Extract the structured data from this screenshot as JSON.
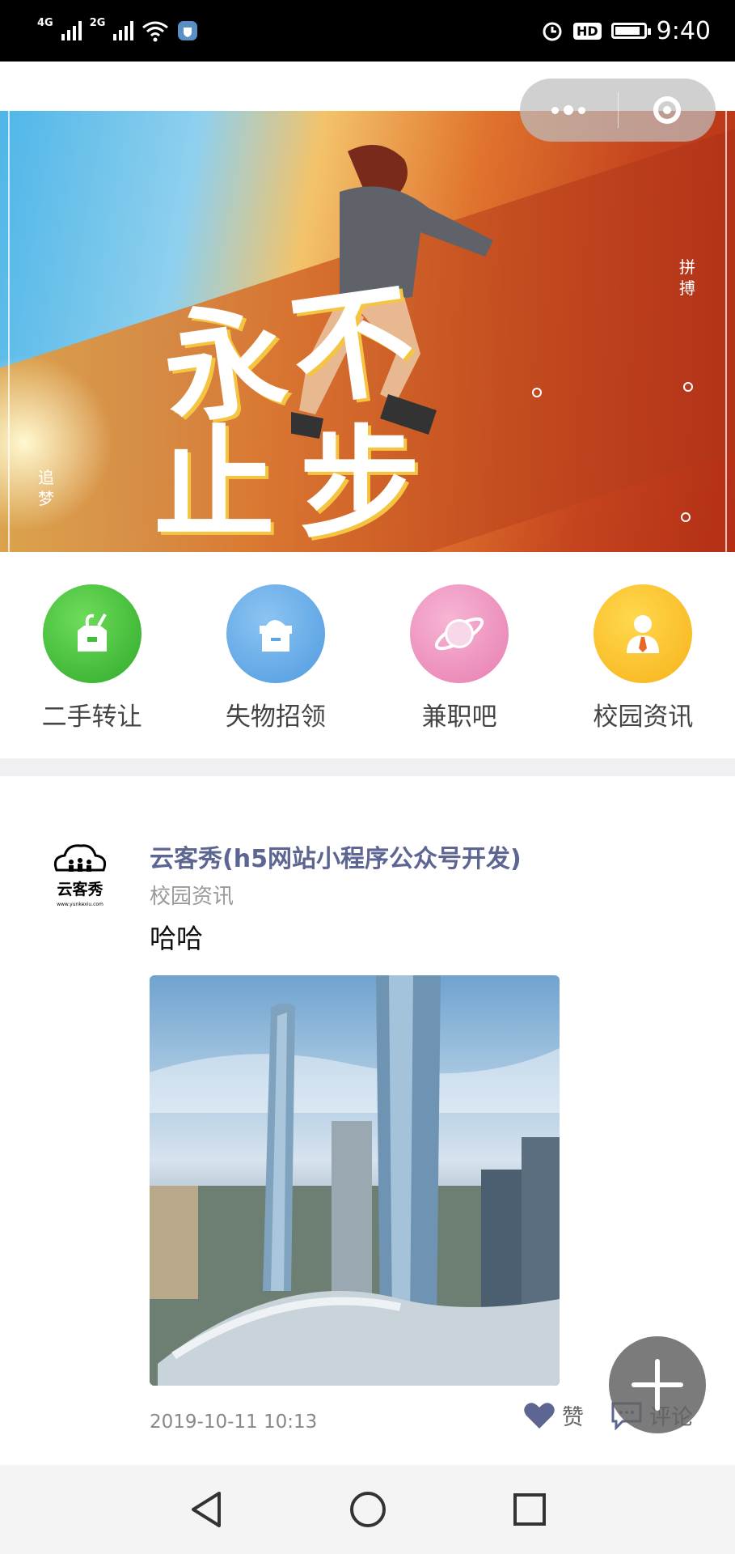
{
  "status_bar": {
    "network_left": "4G",
    "network_right": "2G",
    "hd": "HD",
    "time": "9:40"
  },
  "banner": {
    "slogan_line1": "永不",
    "slogan_line2": "止步",
    "tag_right": "拼搏",
    "tag_left": "追梦",
    "colors": {
      "sky": "#4fb6e8",
      "wall": "#c5441e",
      "accent": "#f5c542"
    }
  },
  "categories": [
    {
      "label": "二手转让",
      "icon": "shopping-bag-icon",
      "color": "#3fbf36"
    },
    {
      "label": "失物招领",
      "icon": "box-icon",
      "color": "#5aa6e6"
    },
    {
      "label": "兼职吧",
      "icon": "planet-icon",
      "color": "#ec8fbd"
    },
    {
      "label": "校园资讯",
      "icon": "person-icon",
      "color": "#f9c02a"
    }
  ],
  "post": {
    "author": "云客秀(h5网站小程序公众号开发)",
    "avatar_text": "云客秀",
    "avatar_url_text": "www.yunkexiu.com",
    "category": "校园资讯",
    "content": "哈哈",
    "timestamp": "2019-10-11 10:13",
    "like_label": "赞",
    "comment_label": "评论",
    "accent_color": "#5d6592"
  },
  "fab": {
    "icon": "plus-icon"
  },
  "nav": {
    "back_icon": "back-triangle-icon",
    "home_icon": "home-circle-icon",
    "recents_icon": "recents-square-icon"
  }
}
